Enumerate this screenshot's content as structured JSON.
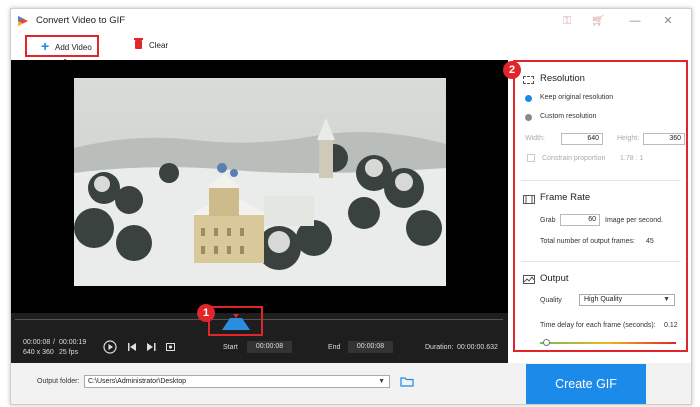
{
  "window": {
    "title": "Convert Video to GIF"
  },
  "toolbar": {
    "add_video": "Add Video",
    "clear": "Clear"
  },
  "player": {
    "current_time": "00:00:08",
    "separator": "/",
    "total_time": "00:00:19",
    "resolution": "640 x 360",
    "fps": "25 fps",
    "start_label": "Start",
    "start_value": "00:00:08",
    "end_label": "End",
    "end_value": "00:00:08",
    "duration_label": "Duration:",
    "duration_value": "00:00:00.632"
  },
  "badges": {
    "one": "1",
    "two": "2"
  },
  "resolution": {
    "title": "Resolution",
    "keep_original": "Keep original resolution",
    "custom": "Custom resolution",
    "width_label": "Width:",
    "width_value": "640",
    "height_label": "Height:",
    "height_value": "360",
    "constrain": "Constrain proportion",
    "ratio": "1.78 : 1"
  },
  "frame_rate": {
    "title": "Frame Rate",
    "grab_label": "Grab",
    "grab_value": "60",
    "grab_suffix": "Image per second.",
    "total_label": "Total number of output frames:",
    "total_value": "45"
  },
  "output": {
    "title": "Output",
    "quality_label": "Quality",
    "quality_value": "High Quality",
    "delay_label": "Time delay for each frame (seconds):",
    "delay_value": "0.12",
    "delay_slider_fraction": 0.05
  },
  "footer": {
    "folder_label": "Output folder:",
    "folder_path": "C:\\Users\\Administrator\\Desktop",
    "create_gif": "Create GIF"
  },
  "colors": {
    "accent": "#1b8ae8",
    "highlight": "#e0262b",
    "player_bg": "#000000"
  }
}
